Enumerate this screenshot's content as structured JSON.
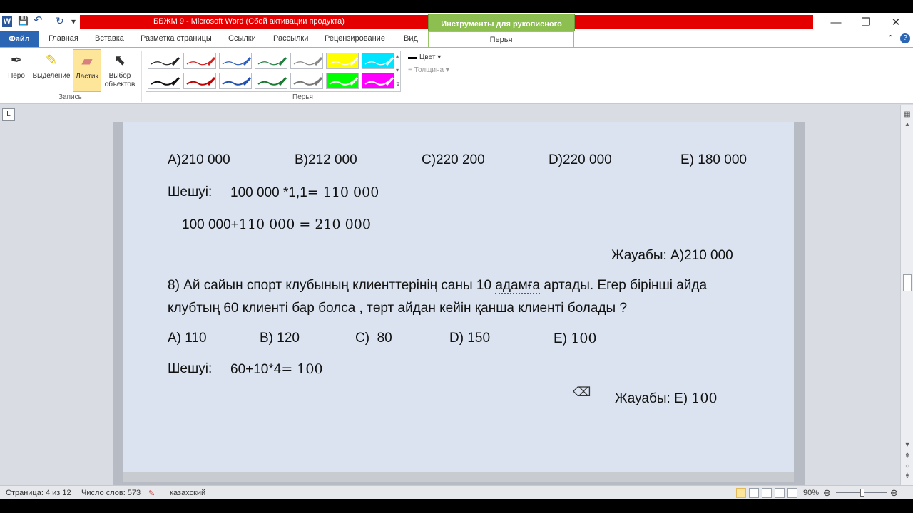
{
  "window": {
    "title": "ББЖМ 9  -  Microsoft Word (Сбой активации продукта)",
    "context_tab": "Инструменты для рукописного ввода",
    "minimize": "—",
    "restore": "❐",
    "close": "✕"
  },
  "quick_access": {
    "word_icon": "W",
    "save_icon": "💾",
    "undo_icon": "↶",
    "redo_icon": "↻",
    "dropdown": "▾"
  },
  "menu": {
    "file": "Файл",
    "tabs": [
      "Главная",
      "Вставка",
      "Разметка страницы",
      "Ссылки",
      "Рассылки",
      "Рецензирование",
      "Вид"
    ],
    "pen_tab": "Перья",
    "help": "?",
    "collapse": "⌃"
  },
  "ribbon": {
    "buttons": [
      {
        "label": "Перо",
        "icon": "pen-icon"
      },
      {
        "label": "Выделение",
        "icon": "highlighter-icon"
      },
      {
        "label": "Ластик",
        "icon": "eraser-icon"
      },
      {
        "label": "Выбор объектов",
        "icon": "select-arrow-icon"
      }
    ],
    "group_record": "Запись",
    "group_pens": "Перья",
    "color_label": "Цвет",
    "thickness_label": "Толщина",
    "pen_colors": [
      "#222222",
      "#d02020",
      "#3060c0",
      "#208040",
      "#888888",
      "#ffff00",
      "#00e5ff",
      "#111111",
      "#c00000",
      "#2050b0",
      "#1a7a30",
      "#777777",
      "#00ff00",
      "#ff00ff"
    ]
  },
  "document": {
    "q7_options": [
      "A)210 000",
      "B)212 000",
      "C)220 200",
      "D)220 000",
      "E) 180 000"
    ],
    "sol7_label": "Шешуі:",
    "sol7_line1": "100 000 *1,1",
    "sol7_line1_math": "= 110 000",
    "sol7_line2": "100 000+",
    "sol7_line2_math": "110 000 = 210 000",
    "ans7": "Жауабы: A)210 000",
    "q8_line1_a": "8) Ай сайын спорт клубының клиенттерінің саны 10 ",
    "q8_line1_sq": "адамға",
    "q8_line1_b": " артады. Егер бірінші айда",
    "q8_line2": "клубтың 60 клиенті бар болса , төрт айдан кейін қанша клиенті болады ?",
    "q8_options": [
      "A) 110",
      "B) 120",
      "C)  80",
      "D) 150",
      "E) "
    ],
    "q8_option_e_math": "100",
    "sol8_label": "Шешуі:",
    "sol8_expr": "60+10*4",
    "sol8_math": "= 100",
    "ans8_label": "Жауабы: E) ",
    "ans8_math": "100"
  },
  "status": {
    "page": "Страница: 4 из 12",
    "words": "Число слов: 573",
    "language": "казахский",
    "zoom": "90%",
    "zoom_out": "⊖",
    "zoom_in": "⊕"
  }
}
